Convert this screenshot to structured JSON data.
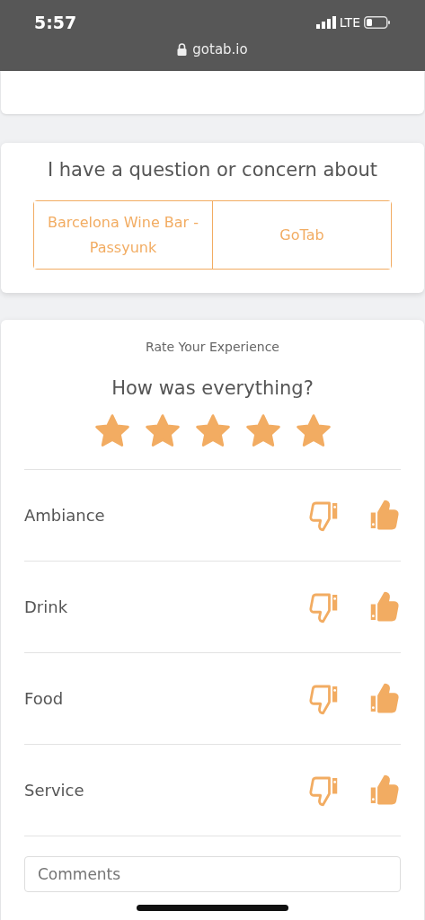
{
  "status_bar": {
    "time": "5:57",
    "network": "LTE"
  },
  "address_bar": {
    "url": "gotab.io"
  },
  "concern": {
    "title": "I have a question or concern about",
    "options": [
      {
        "label": "Barcelona Wine Bar - Passyunk",
        "selected": false
      },
      {
        "label": "GoTab",
        "selected": false
      }
    ]
  },
  "rating": {
    "heading": "Rate Your Experience",
    "question": "How was everything?",
    "stars": 5
  },
  "categories": [
    {
      "label": "Ambiance",
      "thumbs_down": false,
      "thumbs_up": true
    },
    {
      "label": "Drink",
      "thumbs_down": false,
      "thumbs_up": true
    },
    {
      "label": "Food",
      "thumbs_down": false,
      "thumbs_up": true
    },
    {
      "label": "Service",
      "thumbs_down": false,
      "thumbs_up": true
    }
  ],
  "comments": {
    "placeholder": "Comments"
  }
}
